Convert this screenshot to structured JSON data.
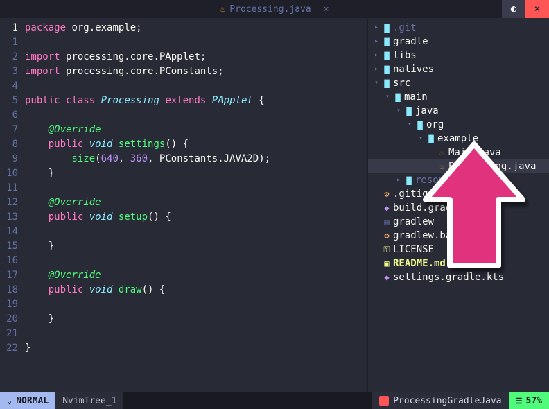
{
  "titlebar": {
    "filename": "Processing.java",
    "icon": "java-icon"
  },
  "editor": {
    "current_line": 1,
    "lines": [
      {
        "n": 1,
        "t": [
          [
            "kw",
            "package"
          ],
          [
            "sp",
            " "
          ],
          [
            "ns",
            "org.example"
          ],
          [
            "punct",
            ";"
          ]
        ]
      },
      {
        "n": 1,
        "t": []
      },
      {
        "n": 2,
        "t": [
          [
            "kw",
            "import"
          ],
          [
            "sp",
            " "
          ],
          [
            "ns",
            "processing.core.PApplet"
          ],
          [
            "punct",
            ";"
          ]
        ]
      },
      {
        "n": 3,
        "t": [
          [
            "kw",
            "import"
          ],
          [
            "sp",
            " "
          ],
          [
            "ns",
            "processing.core.PConstants"
          ],
          [
            "punct",
            ";"
          ]
        ]
      },
      {
        "n": 4,
        "t": []
      },
      {
        "n": 5,
        "t": [
          [
            "kw",
            "public"
          ],
          [
            "sp",
            " "
          ],
          [
            "kw",
            "class"
          ],
          [
            "sp",
            " "
          ],
          [
            "type",
            "Processing"
          ],
          [
            "sp",
            " "
          ],
          [
            "kw",
            "extends"
          ],
          [
            "sp",
            " "
          ],
          [
            "type",
            "PApplet"
          ],
          [
            "sp",
            " "
          ],
          [
            "punct",
            "{"
          ]
        ]
      },
      {
        "n": 6,
        "t": []
      },
      {
        "n": 7,
        "t": [
          [
            "sp",
            "    "
          ],
          [
            "ann",
            "@Override"
          ]
        ]
      },
      {
        "n": 8,
        "t": [
          [
            "sp",
            "    "
          ],
          [
            "kw",
            "public"
          ],
          [
            "sp",
            " "
          ],
          [
            "type",
            "void"
          ],
          [
            "sp",
            " "
          ],
          [
            "fn",
            "settings"
          ],
          [
            "punct",
            "() {"
          ]
        ]
      },
      {
        "n": 9,
        "t": [
          [
            "sp",
            "        "
          ],
          [
            "fn",
            "size"
          ],
          [
            "punct",
            "("
          ],
          [
            "num",
            "640"
          ],
          [
            "punct",
            ", "
          ],
          [
            "num",
            "360"
          ],
          [
            "punct",
            ", "
          ],
          [
            "ns",
            "PConstants.JAVA2D"
          ],
          [
            "punct",
            ");"
          ]
        ]
      },
      {
        "n": 10,
        "t": [
          [
            "sp",
            "    "
          ],
          [
            "punct",
            "}"
          ]
        ]
      },
      {
        "n": 11,
        "t": []
      },
      {
        "n": 12,
        "t": [
          [
            "sp",
            "    "
          ],
          [
            "ann",
            "@Override"
          ]
        ]
      },
      {
        "n": 13,
        "t": [
          [
            "sp",
            "    "
          ],
          [
            "kw",
            "public"
          ],
          [
            "sp",
            " "
          ],
          [
            "type",
            "void"
          ],
          [
            "sp",
            " "
          ],
          [
            "fn",
            "setup"
          ],
          [
            "punct",
            "() {"
          ]
        ]
      },
      {
        "n": 14,
        "t": []
      },
      {
        "n": 15,
        "t": [
          [
            "sp",
            "    "
          ],
          [
            "punct",
            "}"
          ]
        ]
      },
      {
        "n": 16,
        "t": []
      },
      {
        "n": 17,
        "t": [
          [
            "sp",
            "    "
          ],
          [
            "ann",
            "@Override"
          ]
        ]
      },
      {
        "n": 18,
        "t": [
          [
            "sp",
            "    "
          ],
          [
            "kw",
            "public"
          ],
          [
            "sp",
            " "
          ],
          [
            "type",
            "void"
          ],
          [
            "sp",
            " "
          ],
          [
            "fn",
            "draw"
          ],
          [
            "punct",
            "() {"
          ]
        ]
      },
      {
        "n": 19,
        "t": []
      },
      {
        "n": 20,
        "t": [
          [
            "sp",
            "    "
          ],
          [
            "punct",
            "}"
          ]
        ]
      },
      {
        "n": 21,
        "t": []
      },
      {
        "n": 22,
        "t": [
          [
            "punct",
            "}"
          ]
        ]
      }
    ]
  },
  "tree": [
    {
      "depth": 0,
      "tw": "closed",
      "icon": "folder",
      "label": ".git",
      "style": "dim"
    },
    {
      "depth": 0,
      "tw": "closed",
      "icon": "folder",
      "label": "gradle"
    },
    {
      "depth": 0,
      "tw": "closed",
      "icon": "folder",
      "label": "libs"
    },
    {
      "depth": 0,
      "tw": "closed",
      "icon": "folder",
      "label": "natives"
    },
    {
      "depth": 0,
      "tw": "open",
      "icon": "folder-open",
      "label": "src"
    },
    {
      "depth": 1,
      "tw": "open",
      "icon": "folder-open",
      "label": "main"
    },
    {
      "depth": 2,
      "tw": "open",
      "icon": "folder-open",
      "label": "java"
    },
    {
      "depth": 3,
      "tw": "open",
      "icon": "folder-open",
      "label": "org"
    },
    {
      "depth": 4,
      "tw": "open",
      "icon": "folder-open",
      "label": "example"
    },
    {
      "depth": 5,
      "tw": "",
      "icon": "java",
      "label": "Main.java"
    },
    {
      "depth": 5,
      "tw": "",
      "icon": "java",
      "label": "Processing.java",
      "selected": true,
      "cursor_first": true
    },
    {
      "depth": 2,
      "tw": "closed",
      "icon": "folder",
      "label": "resources",
      "style": "dim"
    },
    {
      "depth": 0,
      "tw": "",
      "icon": "gear",
      "label": ".gitignore"
    },
    {
      "depth": 0,
      "tw": "",
      "icon": "gradle",
      "label": "build.gradle.kts"
    },
    {
      "depth": 0,
      "tw": "",
      "icon": "txt",
      "label": "gradlew"
    },
    {
      "depth": 0,
      "tw": "",
      "icon": "gear",
      "label": "gradlew.bat"
    },
    {
      "depth": 0,
      "tw": "",
      "icon": "lic",
      "label": "LICENSE"
    },
    {
      "depth": 0,
      "tw": "",
      "icon": "md",
      "label": "README.md",
      "style": "hl"
    },
    {
      "depth": 0,
      "tw": "",
      "icon": "gradle",
      "label": "settings.gradle.kts"
    }
  ],
  "status": {
    "mode": "NORMAL",
    "buffer": "NvimTree_1",
    "branch": "ProcessingGradleJava",
    "percent": "57%"
  },
  "icon_glyphs": {
    "folder": "▇",
    "folder-open": "▇",
    "java": "♨",
    "gear": "⚙",
    "gradle": "◆",
    "txt": "▤",
    "lic": "⚿",
    "md": "▣"
  }
}
